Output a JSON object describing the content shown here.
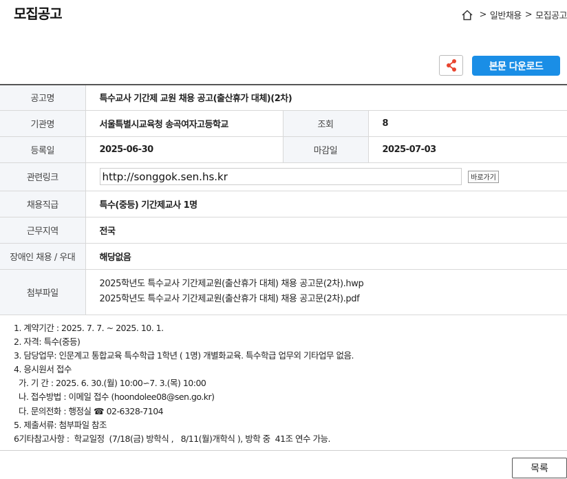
{
  "page": {
    "title": "모집공고",
    "breadcrumb": [
      ">",
      "일반채용",
      ">",
      "모집공고"
    ]
  },
  "toolbar": {
    "share_icon": "share-icon",
    "download_label": "본문 다운로드"
  },
  "info": {
    "title_label": "공고명",
    "title_value": "특수교사 기간제 교원 채용 공고(출산휴가 대체)(2차)",
    "org_label": "기관명",
    "org_value": "서울특별시교육청 송곡여자고등학교",
    "views_label": "조회",
    "views_value": "8",
    "reg_label": "등록일",
    "reg_value": "2025-06-30",
    "deadline_label": "마감일",
    "deadline_value": "2025-07-03",
    "link_label": "관련링크",
    "link_value": "http://songgok.sen.hs.kr",
    "link_button": "바로가기",
    "position_label": "채용직급",
    "position_value": "특수(중등) 기간제교사 1명",
    "region_label": "근무지역",
    "region_value": "전국",
    "disabled_label": "장애인 채용 / 우대",
    "disabled_value": "해당없음",
    "attach_label": "첨부파일",
    "attachments": [
      "2025학년도 특수교사 기간제교원(출산휴가 대체) 채용 공고문(2차).hwp",
      "2025학년도 특수교사 기간제교원(출산휴가 대체) 채용 공고문(2차).pdf"
    ]
  },
  "body_lines": [
    "1. 계약기간 : 2025. 7. 7. ~ 2025. 10. 1.",
    "2. 자격: 특수(중등)",
    "3. 담당업무: 인문계고 통합교육 특수학급 1학년 ( 1명) 개별화교육. 특수학급 업무외 기타업무 없음.",
    "4. 응시원서 접수",
    "  가. 기 간 : 2025. 6. 30.(월) 10:00∽7. 3.(목) 10:00",
    "  나. 접수방법 : 이메일 접수 (hoondolee08@sen.go.kr)",
    "  다. 문의전화 : 행정실 ☎ 02-6328-7104",
    "5. 제출서류: 첨부파일 참조",
    "6기타참고사항 :  학교일정  (7/18(금) 방학식 ,   8/11(월)개학식 ), 방학 중  41조 연수 가능."
  ],
  "footer": {
    "list_button": "목록"
  }
}
